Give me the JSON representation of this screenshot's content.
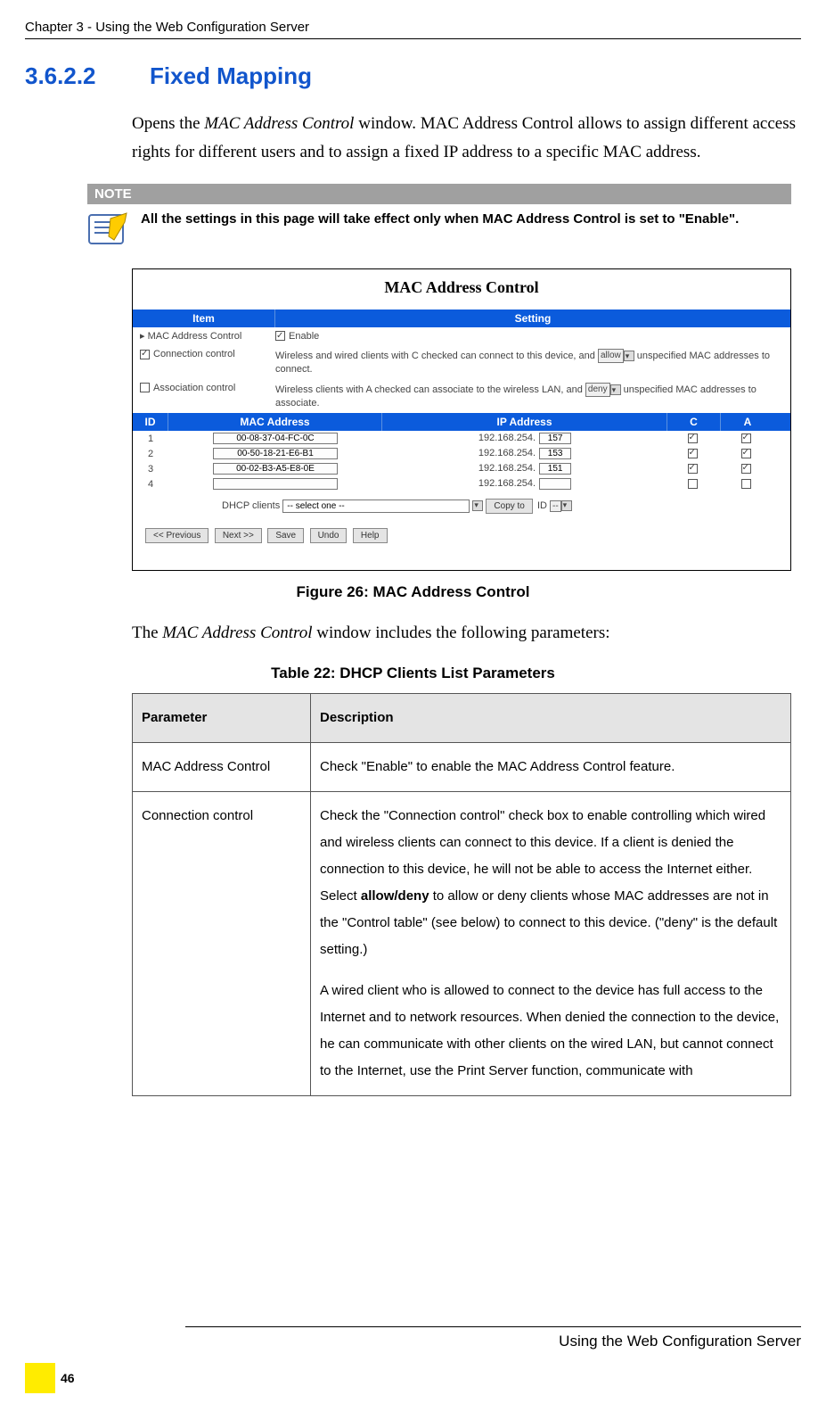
{
  "header": {
    "chapter_line": "Chapter 3 - Using the Web Configuration Server"
  },
  "heading": {
    "number": "3.6.2.2",
    "title": "Fixed Mapping"
  },
  "intro_para": "Opens the MAC Address Control window. MAC Address Control allows to assign different access rights for different users and to assign a fixed IP address to a specific MAC address.",
  "note": {
    "label": "NOTE",
    "text": "All the settings in this page will take effect only when MAC Address Control is set to \"Enable\"."
  },
  "screenshot": {
    "title": "MAC Address Control",
    "headers": {
      "item": "Item",
      "setting": "Setting"
    },
    "rows": {
      "mac_ctrl": {
        "label": "▸ MAC Address Control",
        "enable": "Enable"
      },
      "conn": {
        "label": "Connection control",
        "text_a": "Wireless and wired clients with C checked can connect to this device, and ",
        "opt": "allow",
        "text_b": " unspecified MAC addresses to connect."
      },
      "assoc": {
        "label": "Association control",
        "text_a": "Wireless clients with A checked can associate to the wireless LAN, and ",
        "opt": "deny",
        "text_b": " unspecified MAC addresses to associate."
      }
    },
    "table2": {
      "headers": {
        "id": "ID",
        "mac": "MAC Address",
        "ip": "IP Address",
        "c": "C",
        "a": "A"
      },
      "rows": [
        {
          "id": "1",
          "mac": "00-08-37-04-FC-0C",
          "ip_prefix": "192.168.254.",
          "ip_last": "157",
          "c": true,
          "a": true
        },
        {
          "id": "2",
          "mac": "00-50-18-21-E6-B1",
          "ip_prefix": "192.168.254.",
          "ip_last": "153",
          "c": true,
          "a": true
        },
        {
          "id": "3",
          "mac": "00-02-B3-A5-E8-0E",
          "ip_prefix": "192.168.254.",
          "ip_last": "151",
          "c": true,
          "a": true
        },
        {
          "id": "4",
          "mac": "",
          "ip_prefix": "192.168.254.",
          "ip_last": "",
          "c": false,
          "a": false
        }
      ]
    },
    "dhcp": {
      "label": "DHCP clients",
      "placeholder": "-- select one --",
      "copy": "Copy to",
      "id_label": "ID",
      "id_val": "--"
    },
    "buttons": {
      "prev": "<< Previous",
      "next": "Next >>",
      "save": "Save",
      "undo": "Undo",
      "help": "Help"
    }
  },
  "figure_caption": "Figure 26: MAC Address Control",
  "para2": "The MAC Address Control window includes the following parameters:",
  "table_caption": "Table 22: DHCP Clients List Parameters",
  "param_table": {
    "headers": {
      "param": "Parameter",
      "desc": "Description"
    },
    "rows": [
      {
        "param": "MAC Address Control",
        "desc": "Check \"Enable\" to enable the MAC Address Control feature."
      },
      {
        "param": "Connection control",
        "desc_p1": "Check the \"Connection control\" check box to enable controlling which wired and wireless clients can connect to this device. If a client is denied the connection to this device, he will not be able to access the Internet either. Select allow/deny to allow or deny clients whose MAC addresses are not in the \"Control table\" (see below) to connect to this device. (\"deny\" is the default setting.)",
        "desc_p2": "A wired client who is allowed to connect to the device has full access to the Internet and to network resources. When denied the connection to the device, he can communicate with other clients on the wired LAN, but cannot connect to the Internet, use the Print Server function, communicate with"
      }
    ]
  },
  "footer": {
    "text": "Using the Web Configuration Server",
    "page": "46"
  }
}
